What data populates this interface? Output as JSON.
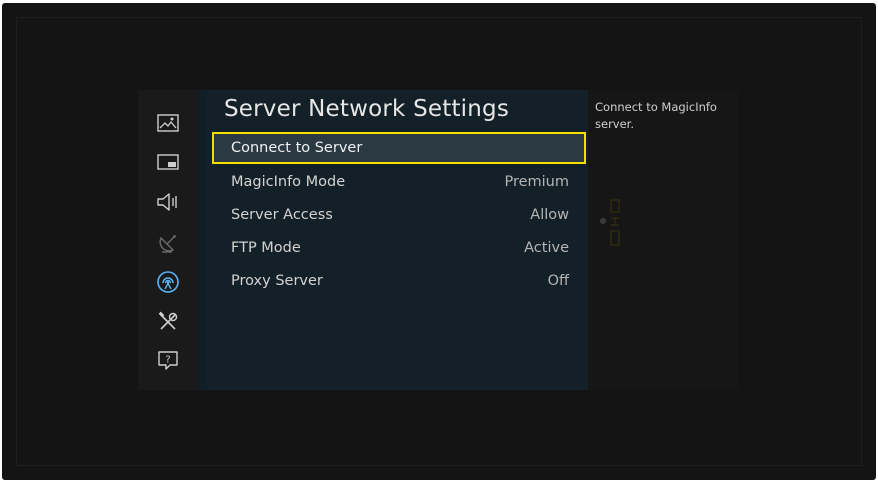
{
  "sidebar": {
    "items": [
      {
        "icon": "picture-icon"
      },
      {
        "icon": "pip-icon"
      },
      {
        "icon": "sound-icon"
      },
      {
        "icon": "broadcasting-icon"
      },
      {
        "icon": "network-icon",
        "active": true
      },
      {
        "icon": "system-tools-icon"
      },
      {
        "icon": "support-icon"
      }
    ],
    "active_color": "#5ab4f5"
  },
  "panel": {
    "title": "Server Network Settings",
    "items": [
      {
        "label": "Connect to Server",
        "value": "",
        "selected": true
      },
      {
        "label": "MagicInfo Mode",
        "value": "Premium"
      },
      {
        "label": "Server Access",
        "value": "Allow"
      },
      {
        "label": "FTP Mode",
        "value": "Active"
      },
      {
        "label": "Proxy Server",
        "value": "Off"
      }
    ]
  },
  "help": {
    "text": "Connect to MagicInfo server."
  },
  "colors": {
    "highlight": "#f0e000",
    "panel_bg": "#142027"
  }
}
